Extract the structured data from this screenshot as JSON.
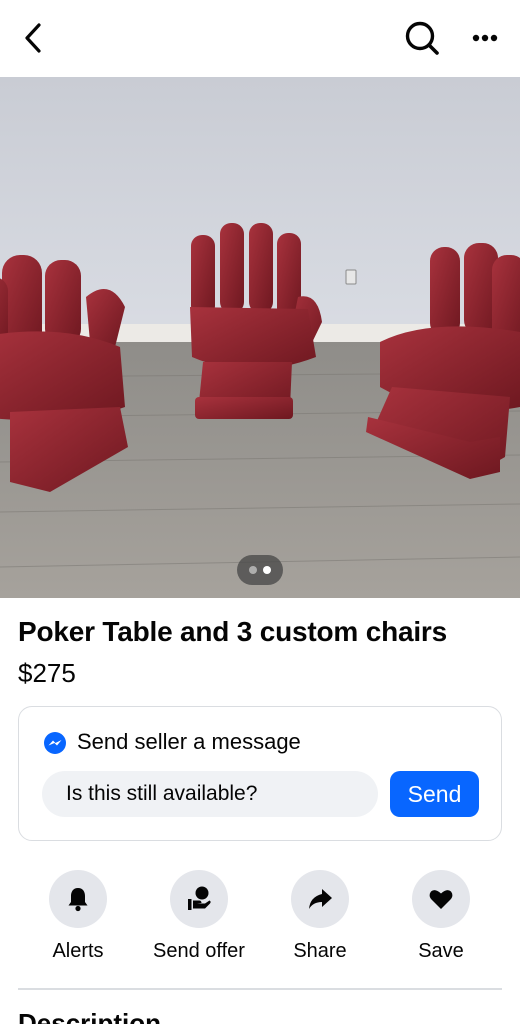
{
  "header": {
    "back_icon": "back-arrow-icon",
    "search_icon": "search-icon",
    "more_icon": "more-options-icon"
  },
  "photo": {
    "pager_total": 2,
    "pager_active": 2
  },
  "listing": {
    "title": "Poker Table and 3 custom chairs",
    "price": "$275"
  },
  "message_card": {
    "heading": "Send seller a message",
    "input_value": "Is this still available?",
    "send_label": "Send",
    "accent_color": "#0866ff"
  },
  "actions": [
    {
      "label": "Alerts",
      "icon": "bell-icon"
    },
    {
      "label": "Send offer",
      "icon": "offer-hand-icon"
    },
    {
      "label": "Share",
      "icon": "share-arrow-icon"
    },
    {
      "label": "Save",
      "icon": "heart-icon"
    }
  ],
  "description_heading": "Description"
}
